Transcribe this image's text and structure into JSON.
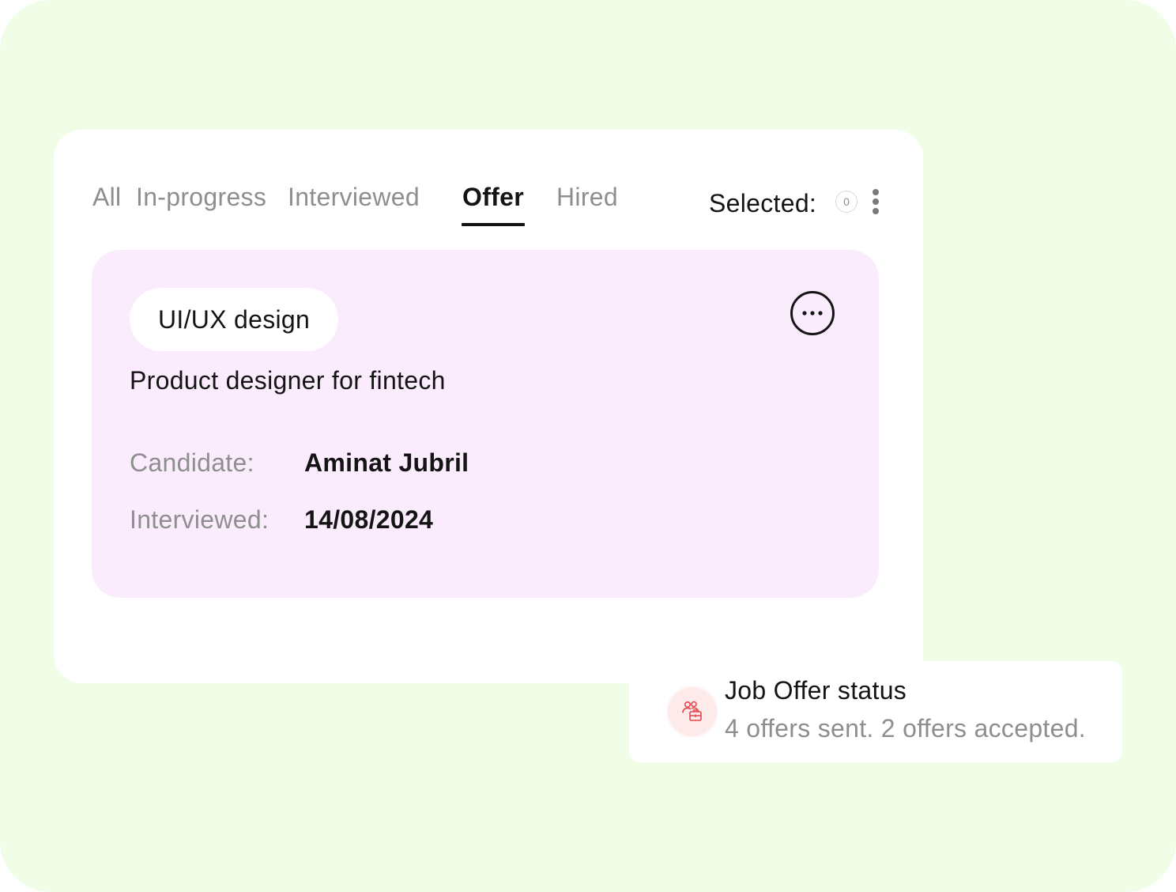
{
  "tabs": [
    {
      "label": "All",
      "active": false
    },
    {
      "label": "In-progress",
      "active": false
    },
    {
      "label": "Interviewed",
      "active": false
    },
    {
      "label": "Offer",
      "active": true
    },
    {
      "label": "Hired",
      "active": false
    }
  ],
  "selection": {
    "label": "Selected:",
    "count": "0"
  },
  "job_card": {
    "tag": "UI/UX design",
    "title": "Product designer for fintech",
    "fields": [
      {
        "label": "Candidate:",
        "value": "Aminat Jubril"
      },
      {
        "label": "Interviewed:",
        "value": "14/08/2024"
      }
    ]
  },
  "toast": {
    "title": "Job Offer status",
    "body": "4 offers sent. 2 offers accepted."
  },
  "icons": {
    "kebab": "vertical-dots-icon",
    "more": "horizontal-dots-circle-icon",
    "toast": "users-briefcase-icon"
  },
  "colors": {
    "background": "#f1fde7",
    "panel": "#ffffff",
    "card": "#fbecfd",
    "text_primary": "#141414",
    "text_muted": "#8e8e8e",
    "toast_icon_bg": "#fdeaea",
    "toast_icon_stroke": "#e5484d"
  }
}
